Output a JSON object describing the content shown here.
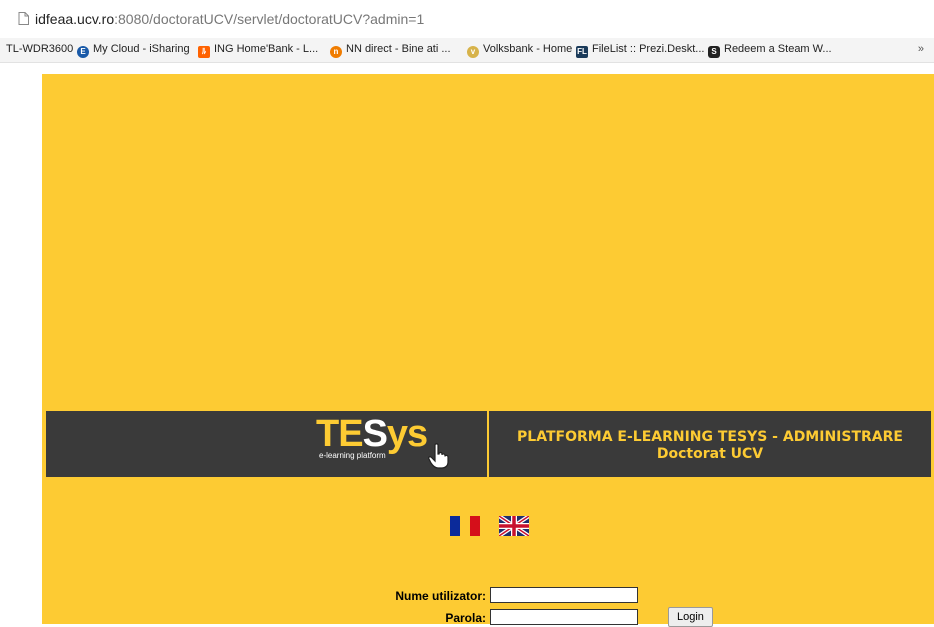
{
  "browser": {
    "url_host": "idfeaa.ucv.ro",
    "url_rest": ":8080/doctoratUCV/servlet/doctoratUCV?admin=1",
    "bookmarks": [
      {
        "label": "TL-WDR3600",
        "icon": "none"
      },
      {
        "label": "My Cloud - iSharing",
        "icon": "mycloud-icon",
        "color": "#1a5aa8"
      },
      {
        "label": "ING Home'Bank - L...",
        "icon": "ing-lion-icon",
        "color": "#ff6200"
      },
      {
        "label": "NN direct - Bine ati ...",
        "icon": "nn-icon",
        "color": "#f07c00"
      },
      {
        "label": "Volksbank - Home",
        "icon": "volksbank-icon",
        "color": "#a07a00"
      },
      {
        "label": "FileList :: Prezi.Deskt...",
        "icon": "filelist-icon",
        "color": "#1b3b5a"
      },
      {
        "label": "Redeem a Steam W...",
        "icon": "steam-icon",
        "color": "#222222"
      }
    ],
    "more": "»"
  },
  "banner": {
    "logo_t": "TE",
    "logo_s": "S",
    "logo_ys": "ys",
    "logo_sub": "e-learning platform",
    "title_line1": "PLATFORMA E-LEARNING TESYS - ADMINISTRARE",
    "title_line2": "Doctorat UCV"
  },
  "languages": [
    {
      "name": "Romana",
      "icon": "flag-ro-icon"
    },
    {
      "name": "English",
      "icon": "flag-uk-icon"
    }
  ],
  "login": {
    "username_label": "Nume utilizator:",
    "username_value": "",
    "password_label": "Parola:",
    "password_value": "",
    "button": "Login"
  },
  "colors": {
    "background": "#fdcb33",
    "banner": "#3a3a3a",
    "accent": "#fdcb33"
  }
}
